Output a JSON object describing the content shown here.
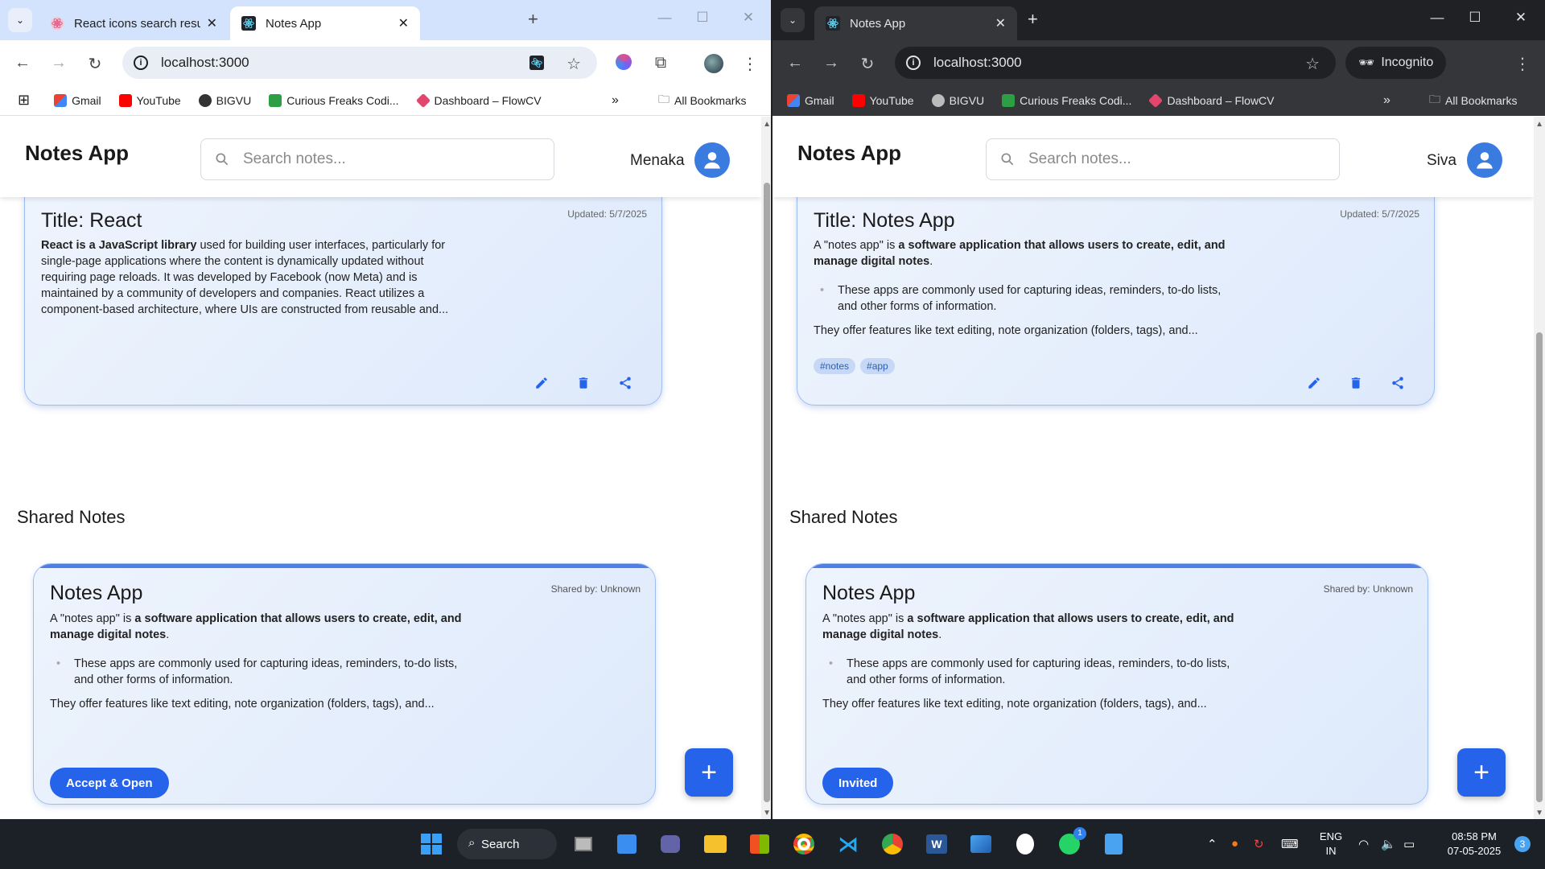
{
  "left_window": {
    "tabs": [
      {
        "label": "React icons search results",
        "active": false
      },
      {
        "label": "Notes App",
        "active": true
      }
    ],
    "url": "localhost:3000",
    "bookmarks": [
      "Gmail",
      "YouTube",
      "BIGVU",
      "Curious Freaks Codi...",
      "Dashboard – FlowCV"
    ],
    "all_bookmarks": "All Bookmarks",
    "header": {
      "title": "Notes App",
      "search_placeholder": "Search notes...",
      "user": "Menaka"
    },
    "note": {
      "title": "Title: React",
      "updated": "Updated: 5/7/2025",
      "body_bold": "React is a JavaScript library",
      "body_rest": " used for building user interfaces, particularly for single-page applications where the content is dynamically updated without requiring page reloads. It was developed by Facebook (now Meta) and is maintained by a community of developers and companies. React utilizes a component-based architecture, where UIs are constructed from reusable and..."
    },
    "shared_section": "Shared Notes",
    "shared": {
      "title": "Notes App",
      "shared_by": "Shared by: Unknown",
      "p1_pre": "A \"notes app\" is ",
      "p1_bold": "a software application that allows users to create, edit, and manage digital notes",
      "p1_post": ".",
      "bullet": "These apps are commonly used for capturing ideas, reminders, to-do lists, and other forms of information.",
      "p2": "They offer features like text editing, note organization (folders, tags), and...",
      "button": "Accept & Open"
    },
    "fab": "+"
  },
  "right_window": {
    "tabs": [
      {
        "label": "Notes App",
        "active": true
      }
    ],
    "url": "localhost:3000",
    "incognito": "Incognito",
    "bookmarks": [
      "Gmail",
      "YouTube",
      "BIGVU",
      "Curious Freaks Codi...",
      "Dashboard – FlowCV"
    ],
    "all_bookmarks": "All Bookmarks",
    "header": {
      "title": "Notes App",
      "search_placeholder": "Search notes...",
      "user": "Siva"
    },
    "note": {
      "title": "Title: Notes App",
      "updated": "Updated: 5/7/2025",
      "p1_pre": "A \"notes app\" is ",
      "p1_bold": "a software application that allows users to create, edit, and manage digital notes",
      "p1_post": ".",
      "bullet": "These apps are commonly used for capturing ideas, reminders, to-do lists, and other forms of information.",
      "p2": "They offer features like text editing, note organization (folders, tags), and...",
      "tags": [
        "#notes",
        "#app"
      ]
    },
    "shared_section": "Shared Notes",
    "shared": {
      "title": "Notes App",
      "shared_by": "Shared by: Unknown",
      "p1_pre": "A \"notes app\" is ",
      "p1_bold": "a software application that allows users to create, edit, and manage digital notes",
      "p1_post": ".",
      "bullet": "These apps are commonly used for capturing ideas, reminders, to-do lists, and other forms of information.",
      "p2": "They offer features like text editing, note organization (folders, tags), and...",
      "button": "Invited"
    },
    "fab": "+"
  },
  "taskbar": {
    "search": "Search",
    "lang_top": "ENG",
    "lang_bottom": "IN",
    "time": "08:58 PM",
    "date": "07-05-2025",
    "notification_count": "3",
    "whatsapp_badge": "1"
  },
  "colors": {
    "accent": "#2563eb",
    "card_border": "#9dbcf0",
    "tab_light": "#d3e3fd",
    "tab_dark": "#202124"
  }
}
